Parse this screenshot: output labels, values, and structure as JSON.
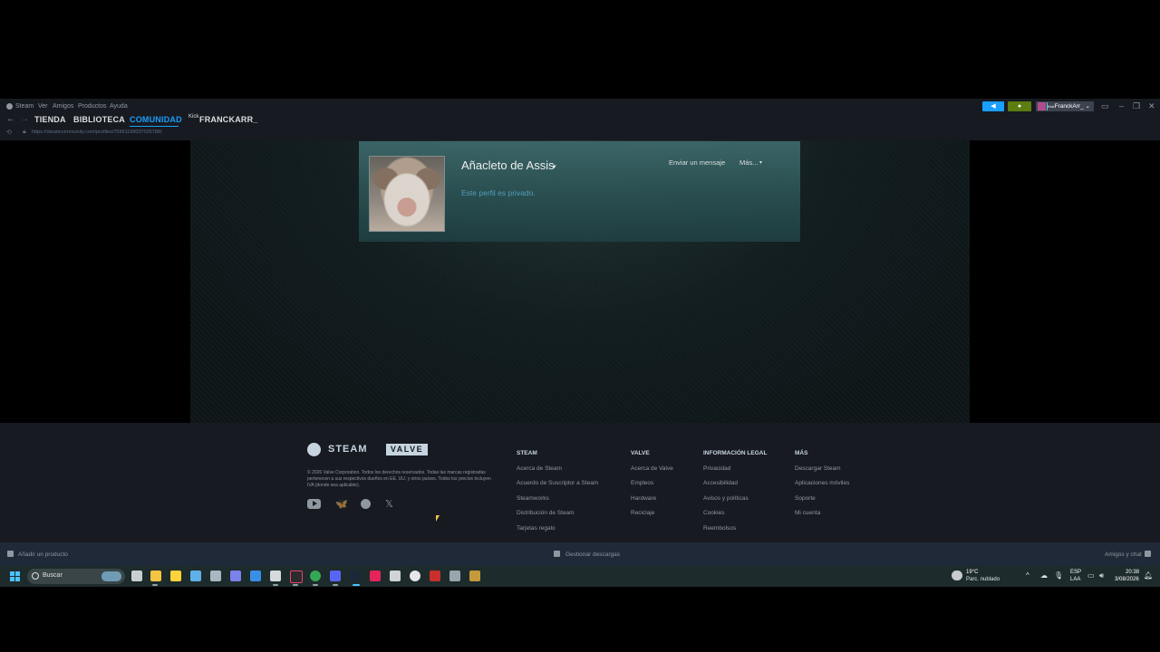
{
  "menubar": {
    "items": [
      "Steam",
      "Ver",
      "Amigos",
      "Productos",
      "Ayuda"
    ]
  },
  "titlebar": {
    "account_name": "FranckArr_",
    "account_prefix": "Kick",
    "caret": "⌄"
  },
  "nav": {
    "back": "←",
    "forward": "→",
    "tabs": [
      "TIENDA",
      "BIBLIOTECA",
      "COMUNIDAD"
    ],
    "kick_prefix": "Kick",
    "username": "FRANCKARR_"
  },
  "url": {
    "text": "https://steamcommunity.com/profiles/76561199037035788/"
  },
  "profile": {
    "persona_name": "Añacleto de Assis",
    "caret": "▾",
    "private_text": "Este perfil es privado.",
    "send_message": "Enviar un mensaje",
    "more": "Más...",
    "more_caret": "▾"
  },
  "footer": {
    "steam_logo": "STEAM",
    "valve_logo": "VALVE",
    "copyright": "© 2026 Valve Corporation. Todos los derechos reservados. Todas las marcas registradas pertenecen a sus respectivos dueños en EE. UU. y otros países. Todos los precios incluyen IVA (donde sea aplicable).",
    "columns": [
      {
        "header": "STEAM",
        "links": [
          "Acerca de Steam",
          "Acuerdo de Suscriptor a Steam",
          "Steamworks",
          "Distribución de Steam",
          "Tarjetas regalo"
        ]
      },
      {
        "header": "VALVE",
        "links": [
          "Acerca de Valve",
          "Empleos",
          "Hardware",
          "Reciclaje"
        ]
      },
      {
        "header": "INFORMACIÓN LEGAL",
        "links": [
          "Privacidad",
          "Accesibilidad",
          "Avisos y políticas",
          "Cookies",
          "Reembolsos"
        ]
      },
      {
        "header": "MÁS",
        "links": [
          "Descargar Steam",
          "Aplicaciones móviles",
          "Soporte",
          "Mi cuenta"
        ]
      }
    ],
    "social": {
      "bluesky": "🦋",
      "x": "𝕏"
    }
  },
  "statusbar": {
    "add_product": "Añadir un producto",
    "downloads": "Gestionar descargas",
    "friends_chat": "Amigos y chat"
  },
  "taskbar": {
    "search_placeholder": "Buscar",
    "weather_temp": "19°C",
    "weather_desc": "Parc. nublado",
    "lang_1": "ESP",
    "lang_2": "LAA",
    "time": "20:38",
    "date": "3/08/2026",
    "tray_up": "^"
  },
  "colors": {
    "accent": "#1a9fff",
    "private_text": "#57a5c9",
    "notification": "#5c7e10"
  }
}
